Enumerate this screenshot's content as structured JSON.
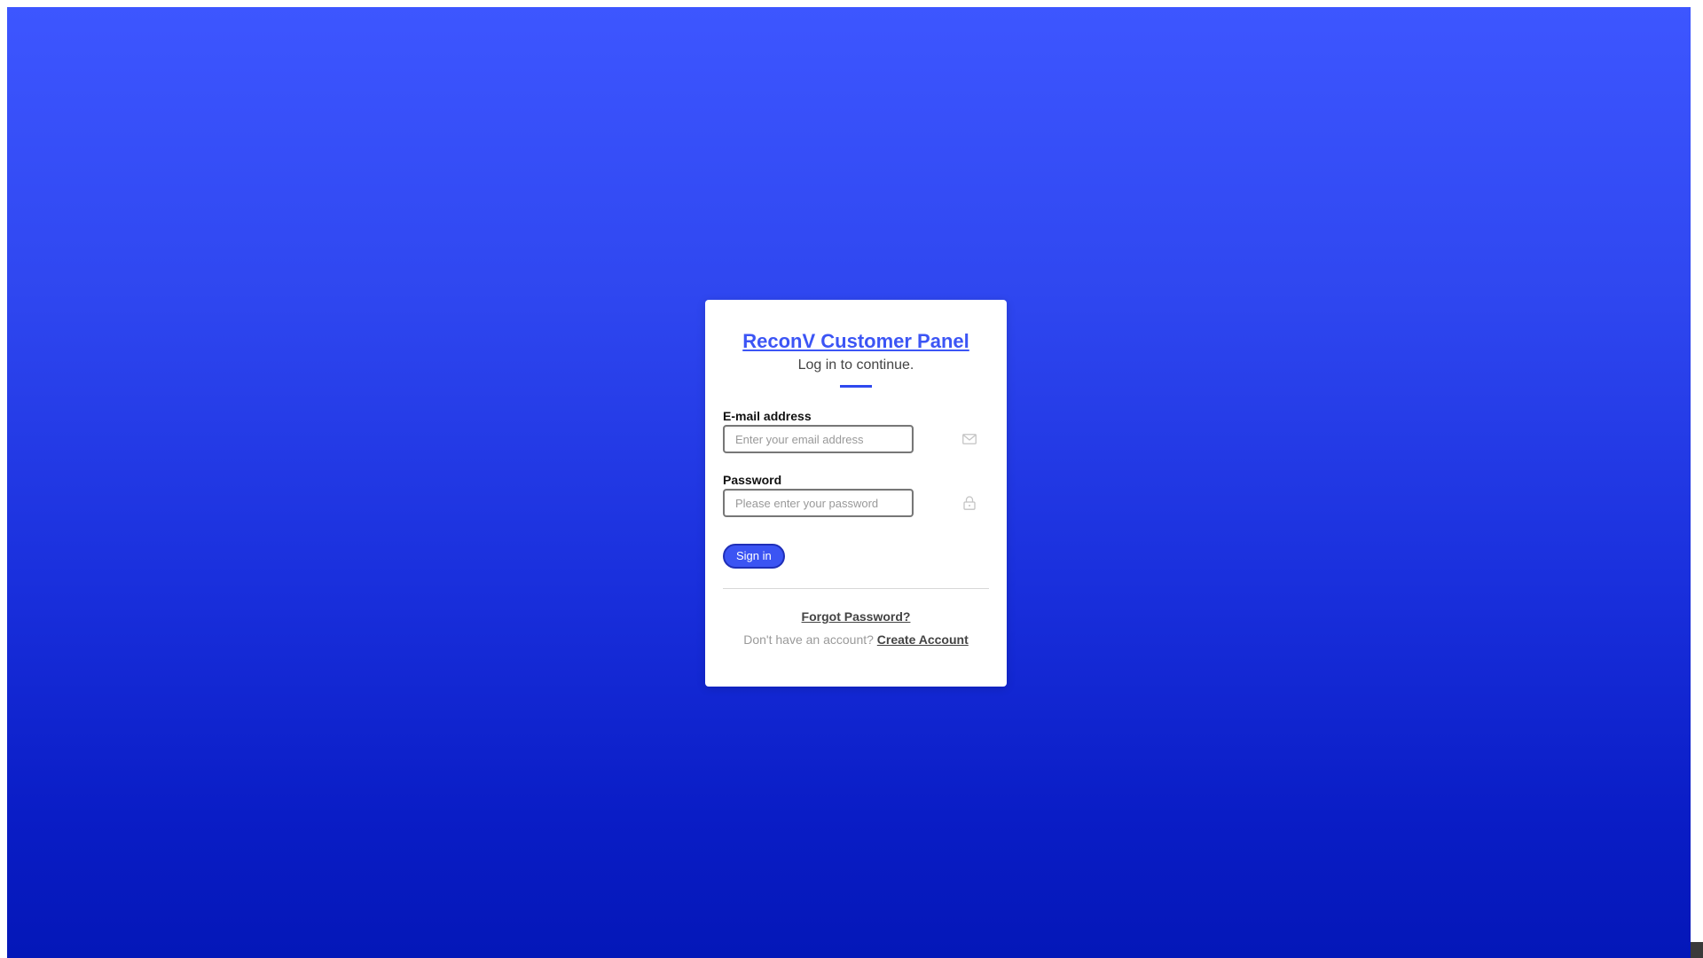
{
  "login": {
    "title": "ReconV Customer Panel",
    "subtitle": "Log in to continue.",
    "email": {
      "label": "E-mail address",
      "placeholder": "Enter your email address",
      "value": "",
      "icon": "envelope-icon"
    },
    "password": {
      "label": "Password",
      "placeholder": "Please enter your password",
      "value": "",
      "icon": "lock-icon"
    },
    "signin_label": "Sign in",
    "forgot_label": "Forgot Password?",
    "signup_prompt": "Don't have an account?",
    "create_account_label": "Create Account"
  },
  "colors": {
    "background_top": "#3d56ff",
    "background_bottom": "#0417b8",
    "accent": "#3c55f5",
    "button": "#3b54f3"
  }
}
